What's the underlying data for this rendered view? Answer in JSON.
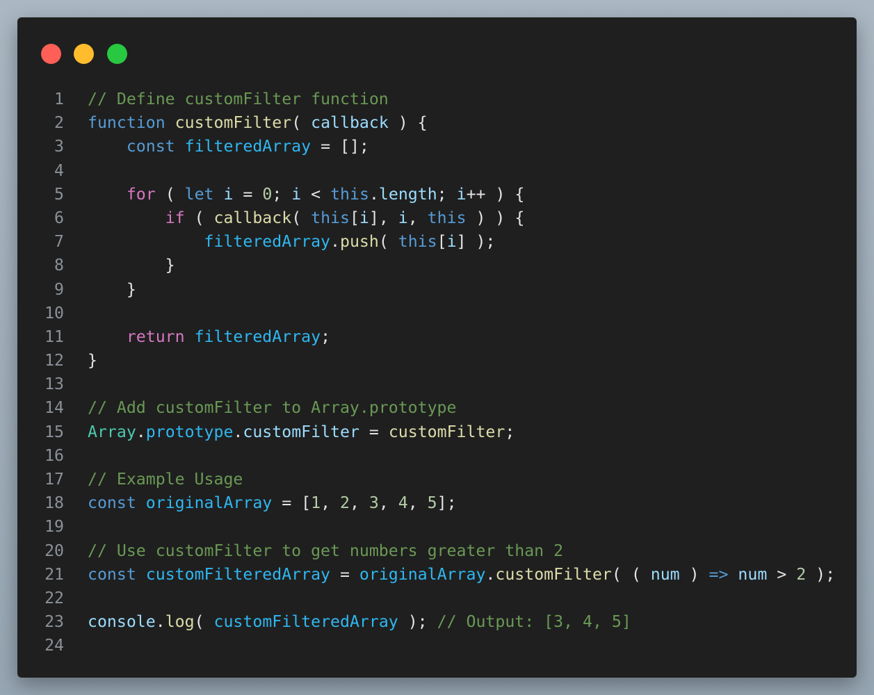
{
  "window": {
    "traffic_lights": {
      "close": "#ff5f57",
      "minimize": "#ffbd2e",
      "maximize": "#28c840"
    }
  },
  "theme": {
    "background": "#1f1f1f",
    "comment": "#6a9955",
    "keyword": "#569cd6",
    "control": "#d678c2",
    "function": "#dcdcaa",
    "parameter": "#9cdcfe",
    "variable": "#2fb7f0",
    "number": "#b5cea8",
    "class": "#4ec9b0",
    "text": "#e4e4e4",
    "line_number": "#8b9198"
  },
  "code": {
    "lines": [
      {
        "num": "1",
        "tokens": [
          {
            "t": "// Define customFilter function",
            "c": "comment"
          }
        ]
      },
      {
        "num": "2",
        "tokens": [
          {
            "t": "function",
            "c": "kw"
          },
          {
            "t": " ",
            "c": "punc"
          },
          {
            "t": "customFilter",
            "c": "fn"
          },
          {
            "t": "( ",
            "c": "punc"
          },
          {
            "t": "callback",
            "c": "param"
          },
          {
            "t": " ) {",
            "c": "punc"
          }
        ]
      },
      {
        "num": "3",
        "tokens": [
          {
            "t": "    ",
            "c": "punc"
          },
          {
            "t": "const",
            "c": "kw"
          },
          {
            "t": " ",
            "c": "punc"
          },
          {
            "t": "filteredArray",
            "c": "var"
          },
          {
            "t": " = [];",
            "c": "punc"
          }
        ]
      },
      {
        "num": "4",
        "tokens": []
      },
      {
        "num": "5",
        "tokens": [
          {
            "t": "    ",
            "c": "punc"
          },
          {
            "t": "for",
            "c": "ctrl"
          },
          {
            "t": " ( ",
            "c": "punc"
          },
          {
            "t": "let",
            "c": "kw"
          },
          {
            "t": " ",
            "c": "punc"
          },
          {
            "t": "i",
            "c": "param"
          },
          {
            "t": " = ",
            "c": "punc"
          },
          {
            "t": "0",
            "c": "num"
          },
          {
            "t": "; ",
            "c": "punc"
          },
          {
            "t": "i",
            "c": "param"
          },
          {
            "t": " < ",
            "c": "punc"
          },
          {
            "t": "this",
            "c": "this"
          },
          {
            "t": ".",
            "c": "punc"
          },
          {
            "t": "length",
            "c": "prop"
          },
          {
            "t": "; ",
            "c": "punc"
          },
          {
            "t": "i",
            "c": "param"
          },
          {
            "t": "++ ) {",
            "c": "punc"
          }
        ]
      },
      {
        "num": "6",
        "tokens": [
          {
            "t": "        ",
            "c": "punc"
          },
          {
            "t": "if",
            "c": "ctrl"
          },
          {
            "t": " ( ",
            "c": "punc"
          },
          {
            "t": "callback",
            "c": "fn"
          },
          {
            "t": "( ",
            "c": "punc"
          },
          {
            "t": "this",
            "c": "this"
          },
          {
            "t": "[",
            "c": "punc"
          },
          {
            "t": "i",
            "c": "param"
          },
          {
            "t": "], ",
            "c": "punc"
          },
          {
            "t": "i",
            "c": "param"
          },
          {
            "t": ", ",
            "c": "punc"
          },
          {
            "t": "this",
            "c": "this"
          },
          {
            "t": " ) ) {",
            "c": "punc"
          }
        ]
      },
      {
        "num": "7",
        "tokens": [
          {
            "t": "            ",
            "c": "punc"
          },
          {
            "t": "filteredArray",
            "c": "var"
          },
          {
            "t": ".",
            "c": "punc"
          },
          {
            "t": "push",
            "c": "fn"
          },
          {
            "t": "( ",
            "c": "punc"
          },
          {
            "t": "this",
            "c": "this"
          },
          {
            "t": "[",
            "c": "punc"
          },
          {
            "t": "i",
            "c": "param"
          },
          {
            "t": "] );",
            "c": "punc"
          }
        ]
      },
      {
        "num": "8",
        "tokens": [
          {
            "t": "        }",
            "c": "punc"
          }
        ]
      },
      {
        "num": "9",
        "tokens": [
          {
            "t": "    }",
            "c": "punc"
          }
        ]
      },
      {
        "num": "10",
        "tokens": []
      },
      {
        "num": "11",
        "tokens": [
          {
            "t": "    ",
            "c": "punc"
          },
          {
            "t": "return",
            "c": "ctrl"
          },
          {
            "t": " ",
            "c": "punc"
          },
          {
            "t": "filteredArray",
            "c": "var"
          },
          {
            "t": ";",
            "c": "punc"
          }
        ]
      },
      {
        "num": "12",
        "tokens": [
          {
            "t": "}",
            "c": "punc"
          }
        ]
      },
      {
        "num": "13",
        "tokens": []
      },
      {
        "num": "14",
        "tokens": [
          {
            "t": "// Add customFilter to Array.prototype",
            "c": "comment"
          }
        ]
      },
      {
        "num": "15",
        "tokens": [
          {
            "t": "Array",
            "c": "class"
          },
          {
            "t": ".",
            "c": "punc"
          },
          {
            "t": "prototype",
            "c": "var"
          },
          {
            "t": ".",
            "c": "punc"
          },
          {
            "t": "customFilter",
            "c": "prop"
          },
          {
            "t": " = ",
            "c": "punc"
          },
          {
            "t": "customFilter",
            "c": "fn"
          },
          {
            "t": ";",
            "c": "punc"
          }
        ]
      },
      {
        "num": "16",
        "tokens": []
      },
      {
        "num": "17",
        "tokens": [
          {
            "t": "// Example Usage",
            "c": "comment"
          }
        ]
      },
      {
        "num": "18",
        "tokens": [
          {
            "t": "const",
            "c": "kw"
          },
          {
            "t": " ",
            "c": "punc"
          },
          {
            "t": "originalArray",
            "c": "var"
          },
          {
            "t": " = [",
            "c": "punc"
          },
          {
            "t": "1",
            "c": "num"
          },
          {
            "t": ", ",
            "c": "punc"
          },
          {
            "t": "2",
            "c": "num"
          },
          {
            "t": ", ",
            "c": "punc"
          },
          {
            "t": "3",
            "c": "num"
          },
          {
            "t": ", ",
            "c": "punc"
          },
          {
            "t": "4",
            "c": "num"
          },
          {
            "t": ", ",
            "c": "punc"
          },
          {
            "t": "5",
            "c": "num"
          },
          {
            "t": "];",
            "c": "punc"
          }
        ]
      },
      {
        "num": "19",
        "tokens": []
      },
      {
        "num": "20",
        "tokens": [
          {
            "t": "// Use customFilter to get numbers greater than 2",
            "c": "comment"
          }
        ]
      },
      {
        "num": "21",
        "tokens": [
          {
            "t": "const",
            "c": "kw"
          },
          {
            "t": " ",
            "c": "punc"
          },
          {
            "t": "customFilteredArray",
            "c": "var"
          },
          {
            "t": " = ",
            "c": "punc"
          },
          {
            "t": "originalArray",
            "c": "var"
          },
          {
            "t": ".",
            "c": "punc"
          },
          {
            "t": "customFilter",
            "c": "fn"
          },
          {
            "t": "( ( ",
            "c": "punc"
          },
          {
            "t": "num",
            "c": "param"
          },
          {
            "t": " ) ",
            "c": "punc"
          },
          {
            "t": "=>",
            "c": "kw"
          },
          {
            "t": " ",
            "c": "punc"
          },
          {
            "t": "num",
            "c": "param"
          },
          {
            "t": " > ",
            "c": "punc"
          },
          {
            "t": "2",
            "c": "num"
          },
          {
            "t": " );",
            "c": "punc"
          }
        ]
      },
      {
        "num": "22",
        "tokens": []
      },
      {
        "num": "23",
        "tokens": [
          {
            "t": "console",
            "c": "param"
          },
          {
            "t": ".",
            "c": "punc"
          },
          {
            "t": "log",
            "c": "fn"
          },
          {
            "t": "( ",
            "c": "punc"
          },
          {
            "t": "customFilteredArray",
            "c": "var"
          },
          {
            "t": " ); ",
            "c": "punc"
          },
          {
            "t": "// Output: [3, 4, 5]",
            "c": "comment"
          }
        ]
      },
      {
        "num": "24",
        "tokens": []
      }
    ]
  }
}
